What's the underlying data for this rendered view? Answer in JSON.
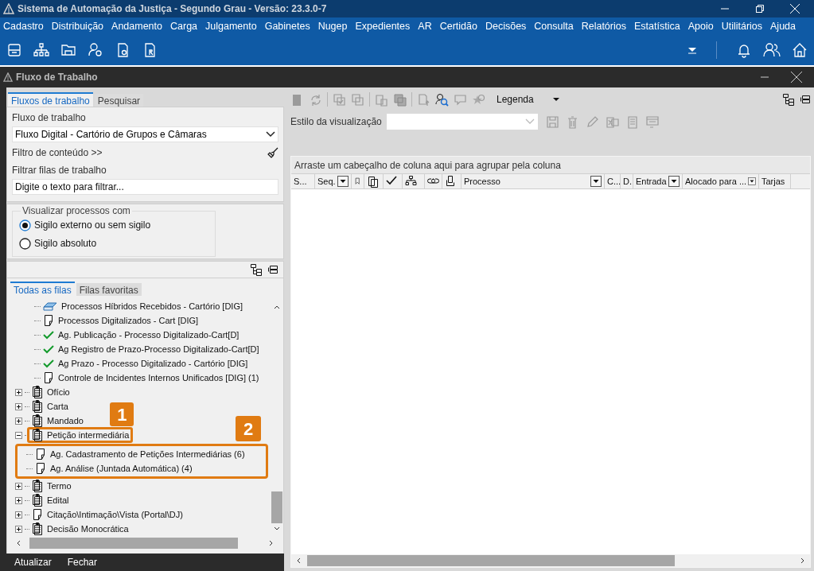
{
  "window": {
    "title": "Sistema de Automação da Justiça - Segundo Grau - Versão: 23.3.0-7"
  },
  "menu": [
    "Cadastro",
    "Distribuição",
    "Andamento",
    "Carga",
    "Julgamento",
    "Gabinetes",
    "Nugep",
    "Expedientes",
    "AR",
    "Certidão",
    "Decisões",
    "Consulta",
    "Relatórios",
    "Estatística",
    "Apoio",
    "Utilitários",
    "Ajuda"
  ],
  "subwindow": {
    "title": "Fluxo de Trabalho"
  },
  "left_tabs": [
    {
      "label": "Fluxos de trabalho",
      "selected": true
    },
    {
      "label": "Pesquisar",
      "selected": false
    }
  ],
  "workflow": {
    "label": "Fluxo de trabalho",
    "value": "Fluxo Digital - Cartório de Grupos e Câmaras",
    "content_filter": "Filtro de conteúdo >>",
    "filter_label": "Filtrar filas de trabalho",
    "filter_placeholder": "Digite o texto para filtrar..."
  },
  "visibility": {
    "legend": "Visualizar processos com",
    "options": [
      {
        "label": "Sigilo externo ou sem sigilo",
        "selected": true
      },
      {
        "label": "Sigilo absoluto",
        "selected": false
      }
    ]
  },
  "queue_tabs": [
    {
      "label": "Todas as filas",
      "selected": true
    },
    {
      "label": "Filas favoritas",
      "selected": false
    }
  ],
  "tree": {
    "continued_children": [
      {
        "label": "Processos Híbridos Recebidos - Cartório [DIG]",
        "kind": "scanner"
      },
      {
        "label": "Processos Digitalizados - Cart [DIG]",
        "kind": "document"
      },
      {
        "label": "Ag. Publicação - Processo Digitalizado-Cart[D]",
        "kind": "check"
      },
      {
        "label": "Ag Registro de Prazo-Processo Digitalizado-Cart[D]",
        "kind": "check"
      },
      {
        "label": "Ag Prazo - Processo Digitalizado - Cartório [DIG]",
        "kind": "check"
      },
      {
        "label": "Controle de Incidentes Internos Unificados [DIG] (1)",
        "kind": "document"
      }
    ],
    "nodes": [
      {
        "label": "Ofício",
        "kind": "clipboard",
        "expanded": false
      },
      {
        "label": "Carta",
        "kind": "clipboard",
        "expanded": false
      },
      {
        "label": "Mandado",
        "kind": "clipboard",
        "expanded": false
      },
      {
        "label": "Petição intermediária",
        "kind": "clipboard",
        "expanded": true,
        "callout": "1",
        "children_callout": "2",
        "children": [
          {
            "label": "Ag. Cadastramento de Petições Intermediárias (6)",
            "kind": "document"
          },
          {
            "label": "Ag. Análise (Juntada Automática) (4)",
            "kind": "document"
          }
        ]
      },
      {
        "label": "Termo",
        "kind": "clipboard",
        "expanded": false
      },
      {
        "label": "Edital",
        "kind": "clipboard",
        "expanded": false
      },
      {
        "label": "Citação\\Intimação\\Vista (Portal\\DJ)",
        "kind": "document",
        "expanded": false
      },
      {
        "label": "Decisão Monocrática",
        "kind": "clipboard",
        "expanded": false
      }
    ]
  },
  "footer_buttons": [
    "Atualizar",
    "Fechar"
  ],
  "grid": {
    "legend_button": "Legenda",
    "style_label": "Estilo da visualização",
    "group_hint": "Arraste um cabeçalho de coluna aqui para agrupar pela coluna",
    "columns": [
      {
        "kind": "text",
        "label": "S...",
        "filter": false
      },
      {
        "kind": "text",
        "label": "Seq.",
        "filter": true
      },
      {
        "kind": "icon",
        "filter": false
      },
      {
        "kind": "icon",
        "filter": false
      },
      {
        "kind": "icon",
        "filter": false
      },
      {
        "kind": "icon",
        "filter": false
      },
      {
        "kind": "icon",
        "filter": false
      },
      {
        "kind": "icon",
        "filter": false
      },
      {
        "kind": "text",
        "label": "Processo",
        "filter": true
      },
      {
        "kind": "text",
        "label": "C...",
        "filter": false
      },
      {
        "kind": "text",
        "label": "D.",
        "filter": false
      },
      {
        "kind": "text",
        "label": "Entrada",
        "filter": true
      },
      {
        "kind": "text",
        "label": "Alocado para ...",
        "filter": true
      },
      {
        "kind": "text",
        "label": "Tarjas",
        "filter": false
      }
    ]
  }
}
